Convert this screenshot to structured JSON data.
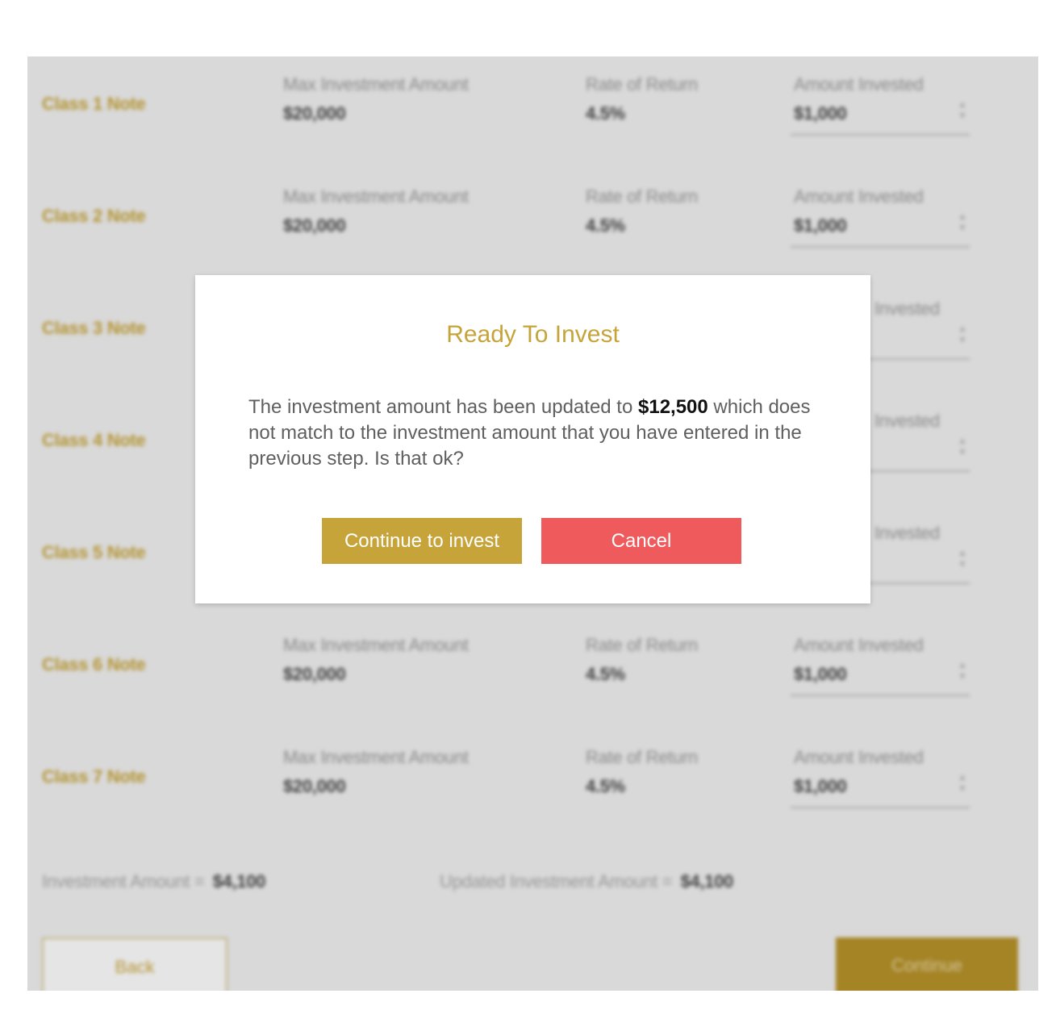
{
  "notes": [
    {
      "title": "Class 1 Note",
      "max_label": "Max Investment Amount",
      "max_value": "$20,000",
      "rate_label": "Rate of Return",
      "rate_value": "4.5%",
      "amount_label": "Amount Invested",
      "amount_value": "$1,000"
    },
    {
      "title": "Class 2 Note",
      "max_label": "Max Investment Amount",
      "max_value": "$20,000",
      "rate_label": "Rate of Return",
      "rate_value": "4.5%",
      "amount_label": "Amount Invested",
      "amount_value": "$1,000"
    },
    {
      "title": "Class 3 Note",
      "max_label": "",
      "max_value": "",
      "rate_label": "",
      "rate_value": "",
      "amount_label": "Invested",
      "amount_value": ""
    },
    {
      "title": "Class 4 Note",
      "max_label": "",
      "max_value": "",
      "rate_label": "",
      "rate_value": "",
      "amount_label": "Invested",
      "amount_value": ""
    },
    {
      "title": "Class 5 Note",
      "max_label": "",
      "max_value": "",
      "rate_label": "",
      "rate_value": "",
      "amount_label": "Invested",
      "amount_value": ""
    },
    {
      "title": "Class 6 Note",
      "max_label": "Max Investment Amount",
      "max_value": "$20,000",
      "rate_label": "Rate of Return",
      "rate_value": "4.5%",
      "amount_label": "Amount Invested",
      "amount_value": "$1,000"
    },
    {
      "title": "Class 7 Note",
      "max_label": "Max Investment Amount",
      "max_value": "$20,000",
      "rate_label": "Rate of Return",
      "rate_value": "4.5%",
      "amount_label": "Amount Invested",
      "amount_value": "$1,000"
    }
  ],
  "summary": {
    "investment_label": "Investment Amount =",
    "investment_value": "$4,100",
    "updated_label": "Updated Investment Amount =",
    "updated_value": "$4,100"
  },
  "footer": {
    "back_label": "Back",
    "continue_label": "Continue"
  },
  "modal": {
    "title": "Ready To Invest",
    "body_before": "The investment amount has been updated to ",
    "body_amount": "$12,500",
    "body_after": " which does not match to the investment amount that you have entered in the previous step. Is that ok?",
    "confirm_label": "Continue to invest",
    "cancel_label": "Cancel"
  },
  "colors": {
    "accent_gold": "#c6a43a",
    "cancel_red": "#ef5a5c",
    "overlay_gray": "#e0e0e0"
  },
  "icons": {
    "stepper": "up-down-stepper-icon"
  }
}
